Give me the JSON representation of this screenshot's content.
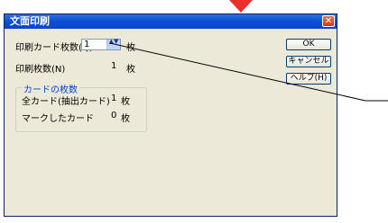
{
  "dialog": {
    "title": "文面印刷",
    "close_glyph": "✕"
  },
  "form": {
    "copies_label": "印刷カード枚数(Q)",
    "copies_value": "1",
    "copies_unit": "枚",
    "spinner_glyph": "▲▼",
    "print_count_label": "印刷枚数(N)",
    "print_count_value": "1",
    "print_count_unit": "枚"
  },
  "group": {
    "title": "カードの枚数",
    "rows": [
      {
        "label": "全カード(抽出カード)",
        "value": "1",
        "unit": "枚"
      },
      {
        "label": "マークしたカード",
        "value": "0",
        "unit": "枚"
      }
    ]
  },
  "buttons": {
    "ok": "OK",
    "cancel": "キャンセル",
    "help": "ヘルプ(H)"
  },
  "colors": {
    "titlebar": "#0a4fd8",
    "dialog_bg": "#ece9d8",
    "group_title": "#0046d5",
    "marker": "#e8302a"
  }
}
